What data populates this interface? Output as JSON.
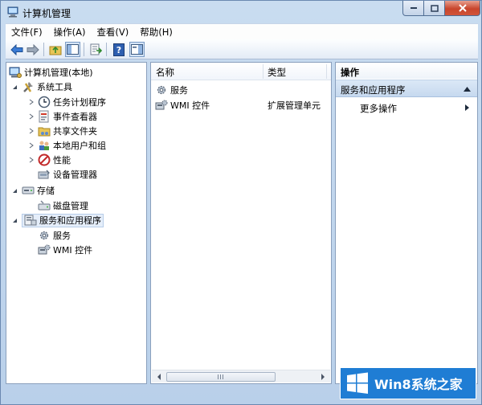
{
  "window": {
    "title": "计算机管理"
  },
  "menu": [
    "文件(F)",
    "操作(A)",
    "查看(V)",
    "帮助(H)"
  ],
  "tree": {
    "root": "计算机管理(本地)",
    "system_tools": "系统工具",
    "task_scheduler": "任务计划程序",
    "event_viewer": "事件查看器",
    "shared_folders": "共享文件夹",
    "local_users": "本地用户和组",
    "performance": "性能",
    "device_manager": "设备管理器",
    "storage": "存储",
    "disk_management": "磁盘管理",
    "services_apps": "服务和应用程序",
    "services": "服务",
    "wmi": "WMI 控件"
  },
  "list": {
    "columns": [
      "名称",
      "类型"
    ],
    "rows": [
      {
        "name": "服务",
        "type": ""
      },
      {
        "name": "WMI 控件",
        "type": "扩展管理单元"
      }
    ]
  },
  "actions": {
    "header": "操作",
    "section": "服务和应用程序",
    "more": "更多操作"
  },
  "watermark": {
    "text": "Win8系统之家"
  },
  "colors": {
    "accent": "#1f7dd4",
    "selection": "#e5eefa",
    "close": "#c8452c"
  }
}
